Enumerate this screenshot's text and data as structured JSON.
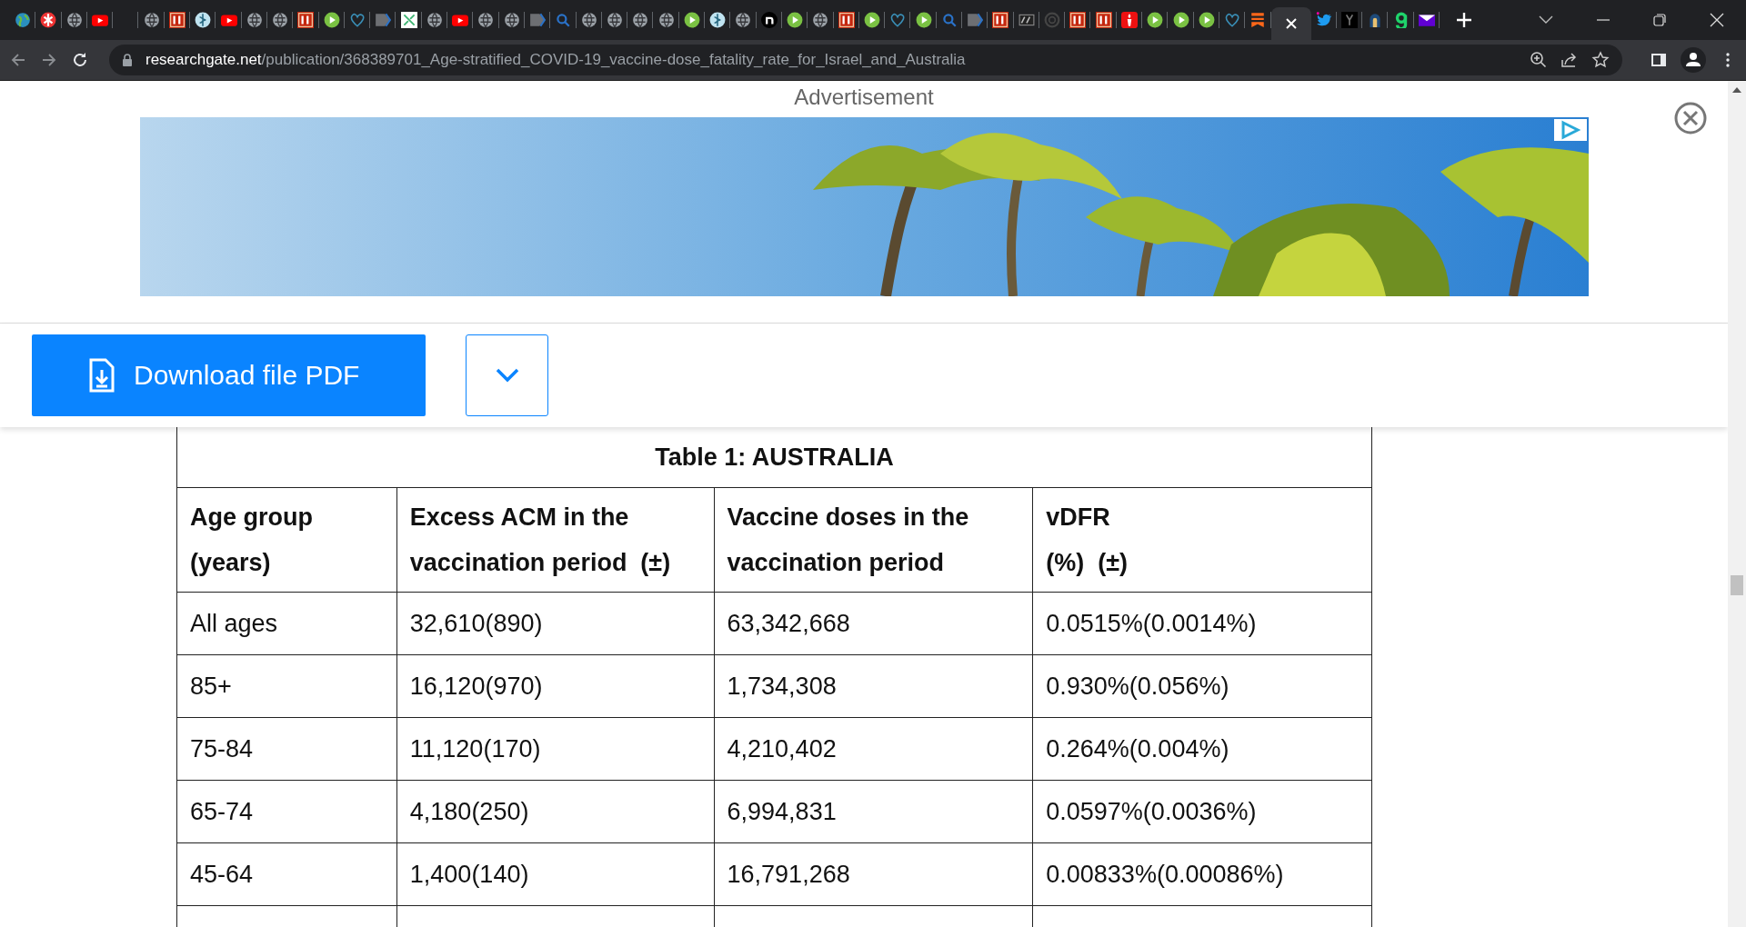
{
  "tabs": [
    {
      "kind": "colorglobe",
      "selected": false
    },
    {
      "kind": "swirl",
      "selected": false
    },
    {
      "kind": "globe",
      "selected": false
    },
    {
      "kind": "youtube",
      "selected": false
    },
    {
      "kind": "blank",
      "selected": false
    },
    {
      "kind": "globe",
      "selected": false
    },
    {
      "kind": "redsquare",
      "selected": false
    },
    {
      "kind": "caduceus",
      "selected": false
    },
    {
      "kind": "youtube",
      "selected": false
    },
    {
      "kind": "globe",
      "selected": false
    },
    {
      "kind": "globe",
      "selected": false
    },
    {
      "kind": "redsquare",
      "selected": false
    },
    {
      "kind": "play",
      "selected": false
    },
    {
      "kind": "heart",
      "selected": false
    },
    {
      "kind": "arrowtag",
      "selected": false
    },
    {
      "kind": "grid",
      "selected": false
    },
    {
      "kind": "globe",
      "selected": false
    },
    {
      "kind": "youtube",
      "selected": false
    },
    {
      "kind": "globe",
      "selected": false
    },
    {
      "kind": "globe",
      "selected": false
    },
    {
      "kind": "arrowtag",
      "selected": false
    },
    {
      "kind": "search",
      "selected": false
    },
    {
      "kind": "globe",
      "selected": false
    },
    {
      "kind": "globe",
      "selected": false
    },
    {
      "kind": "globe",
      "selected": false
    },
    {
      "kind": "globe",
      "selected": false
    },
    {
      "kind": "play",
      "selected": false
    },
    {
      "kind": "caduceus",
      "selected": false
    },
    {
      "kind": "globe",
      "selected": false
    },
    {
      "kind": "blackcircle",
      "selected": false
    },
    {
      "kind": "play",
      "selected": false
    },
    {
      "kind": "globe",
      "selected": false
    },
    {
      "kind": "redsquare",
      "selected": false
    },
    {
      "kind": "play",
      "selected": false
    },
    {
      "kind": "heart",
      "selected": false
    },
    {
      "kind": "play",
      "selected": false
    },
    {
      "kind": "search",
      "selected": false
    },
    {
      "kind": "arrowtag",
      "selected": false
    },
    {
      "kind": "redsquare",
      "selected": false
    },
    {
      "kind": "darkbadge",
      "selected": false
    },
    {
      "kind": "darkring",
      "selected": false
    },
    {
      "kind": "redsquare",
      "selected": false
    },
    {
      "kind": "redsquare",
      "selected": false
    },
    {
      "kind": "torch",
      "selected": false
    },
    {
      "kind": "play",
      "selected": false
    },
    {
      "kind": "play",
      "selected": false
    },
    {
      "kind": "play",
      "selected": false
    },
    {
      "kind": "heart",
      "selected": false
    },
    {
      "kind": "bookmark",
      "selected": false
    },
    {
      "selected": true
    },
    {
      "kind": "bird",
      "selected": false
    },
    {
      "kind": "blacksquare",
      "selected": false
    },
    {
      "kind": "arch",
      "selected": false
    },
    {
      "kind": "greenletter",
      "selected": false
    },
    {
      "kind": "mail",
      "selected": false
    }
  ],
  "address": {
    "host": "researchgate.net",
    "path": "/publication/368389701_Age-stratified_COVID-19_vaccine-dose_fatality_rate_for_Israel_and_Australia"
  },
  "ad": {
    "label": "Advertisement",
    "kind": "picture"
  },
  "download_button": "Download file PDF",
  "table": {
    "title": "Table 1: AUSTRALIA",
    "columns": [
      {
        "lines": [
          "Age group",
          "(years)"
        ]
      },
      {
        "lines": [
          "Excess ACM in the",
          "vaccination period  (±)"
        ]
      },
      {
        "lines": [
          "Vaccine doses in the",
          "vaccination period"
        ]
      },
      {
        "lines": [
          "vDFR",
          "(%)  (±)"
        ]
      }
    ],
    "rows": [
      [
        "All ages",
        "32,610(890)",
        "63,342,668",
        "0.0515%(0.0014%)"
      ],
      [
        "85+",
        "16,120(970)",
        "1,734,308",
        "0.930%(0.056%)"
      ],
      [
        "75-84",
        "11,120(170)",
        "4,210,402",
        "0.264%(0.004%)"
      ],
      [
        "65-74",
        "4,180(250)",
        "6,994,831",
        "0.0597%(0.0036%)"
      ],
      [
        "45-64",
        "1,400(140)",
        "16,791,268",
        "0.00833%(0.00086%)"
      ]
    ]
  }
}
